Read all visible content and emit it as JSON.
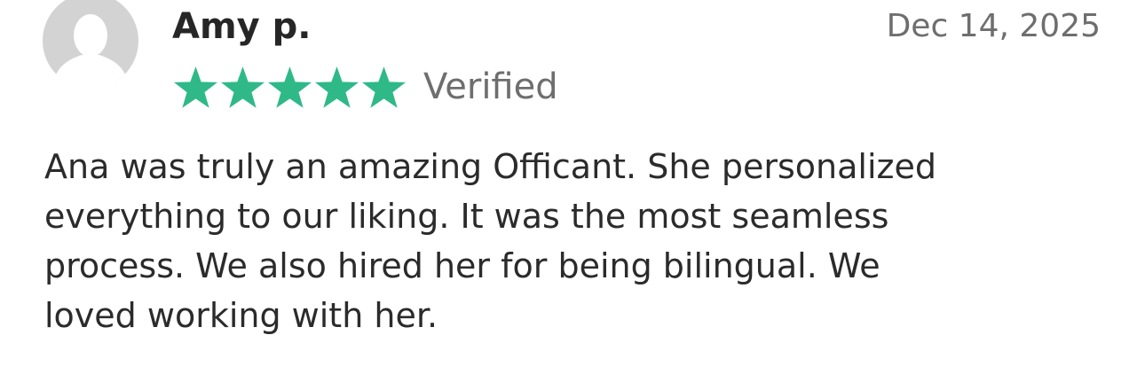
{
  "review": {
    "avatar_icon": "user-placeholder-icon",
    "reviewer_name": "Amy p.",
    "date": "Dec 14, 2025",
    "rating": 5,
    "rating_max": 5,
    "star_icon": "star-icon",
    "star_color": "#2fb988",
    "verified_label": "Verified",
    "text_lines": [
      "Ana was truly an amazing Officant. She personalized",
      "everything to our liking. It was the most seamless",
      "process. We also hired her for being bilingual. We",
      "loved working with her."
    ]
  }
}
